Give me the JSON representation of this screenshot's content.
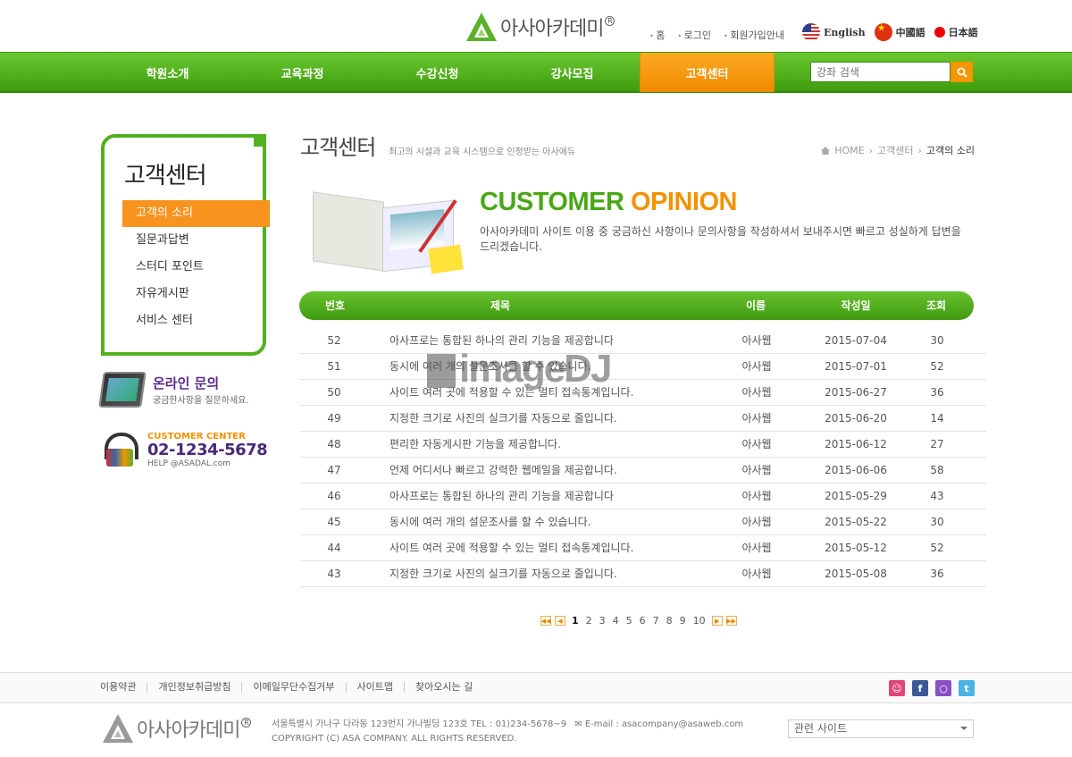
{
  "header": {
    "logo_text": "아사아카데미",
    "top_links": [
      "홈",
      "로그인",
      "회원가입안내"
    ],
    "languages": [
      {
        "label": "English",
        "icon": "us-flag-icon"
      },
      {
        "label": "中國語",
        "icon": "china-flag-icon"
      },
      {
        "label": "日本語",
        "icon": "japan-flag-icon"
      }
    ]
  },
  "nav": {
    "items": [
      "학원소개",
      "교육과정",
      "수강신청",
      "강사모집",
      "고객센터"
    ],
    "active_index": 4,
    "search_placeholder": "강좌 검색"
  },
  "sidebar": {
    "title": "고객센터",
    "items": [
      "고객의 소리",
      "질문과답변",
      "스터디 포인트",
      "자유게시판",
      "서비스 센터"
    ],
    "active_index": 0,
    "online_title": "온라인 문의",
    "online_sub": "궁금한사항을 질문하세요.",
    "cc_label": "CUSTOMER CENTER",
    "cc_phone": "02-1234-5678",
    "cc_mail": "HELP @ASADAL.com"
  },
  "main": {
    "title": "고객센터",
    "subtitle": "최고의 시설과 교육 시스템으로 인정받는 아사에듀",
    "breadcrumb": [
      "HOME",
      "고객센터",
      "고객의 소리"
    ],
    "banner_title_a": "CUSTOMER",
    "banner_title_b": "OPINION",
    "banner_desc": "아사아카데미 사이트 이용 중 궁금하신 사항이나 문의사항을 작성하셔서 보내주시면 빠르고 성실하게 답변을 드리겠습니다.",
    "columns": [
      "번호",
      "제목",
      "이름",
      "작성일",
      "조회"
    ],
    "rows": [
      {
        "no": "52",
        "title": "아사프로는 통합된 하나의 관리 기능을 제공합니다",
        "name": "아사웹",
        "date": "2015-07-04",
        "views": "30"
      },
      {
        "no": "51",
        "title": "동시에 여러 개의 설문조사를 할 수 있습니다.",
        "name": "아사웹",
        "date": "2015-07-01",
        "views": "52"
      },
      {
        "no": "50",
        "title": "사이트 여러 곳에 적용할 수 있는 멀티 접속통계입니다.",
        "name": "아사웹",
        "date": "2015-06-27",
        "views": "36"
      },
      {
        "no": "49",
        "title": "지정한 크기로 사진의 실크기를 자동으로 줄입니다.",
        "name": "아사웹",
        "date": "2015-06-20",
        "views": "14"
      },
      {
        "no": "48",
        "title": "편리한 자동게시판 기능을 제공합니다.",
        "name": "아사웹",
        "date": "2015-06-12",
        "views": "27"
      },
      {
        "no": "47",
        "title": "언제 어디서나 빠르고 강력한 웹메일을 제공합니다.",
        "name": "아사웹",
        "date": "2015-06-06",
        "views": "58"
      },
      {
        "no": "46",
        "title": "아사프로는 통합된 하나의 관리 기능을 제공합니다",
        "name": "아사웹",
        "date": "2015-05-29",
        "views": "43"
      },
      {
        "no": "45",
        "title": "동시에 여러 개의 설문조사를 할 수 있습니다.",
        "name": "아사웹",
        "date": "2015-05-22",
        "views": "30"
      },
      {
        "no": "44",
        "title": "사이트 여러 곳에 적용할 수 있는 멀티 접속통계입니다.",
        "name": "아사웹",
        "date": "2015-05-12",
        "views": "52"
      },
      {
        "no": "43",
        "title": "지정한 크기로 사진의 실크기를 자동으로 줄입니다.",
        "name": "아사웹",
        "date": "2015-05-08",
        "views": "36"
      }
    ],
    "pages": [
      "1",
      "2",
      "3",
      "4",
      "5",
      "6",
      "7",
      "8",
      "9",
      "10"
    ],
    "current_page": "1"
  },
  "watermark": "imageDJ",
  "footer": {
    "links": [
      "이용약관",
      "개인정보취급방침",
      "이메일무단수집거부",
      "사이트맵",
      "찾아오시는 길"
    ],
    "socials": [
      "me2day-icon",
      "facebook-icon",
      "yozm-icon",
      "twitter-icon"
    ],
    "address": "서울특별시 가나구 다라동  123번지 가나빌딩 123호    TEL : 01)234-5678~9",
    "email": "E-mail : asacompany@asaweb.com",
    "copyright": "COPYRIGHT (C) ASA COMPANY. ALL RIGHTS RESERVED.",
    "related_sites": "관련 사이트"
  },
  "colors": {
    "green": "#4aa717",
    "orange": "#f39200",
    "purple": "#5a2a8a"
  }
}
